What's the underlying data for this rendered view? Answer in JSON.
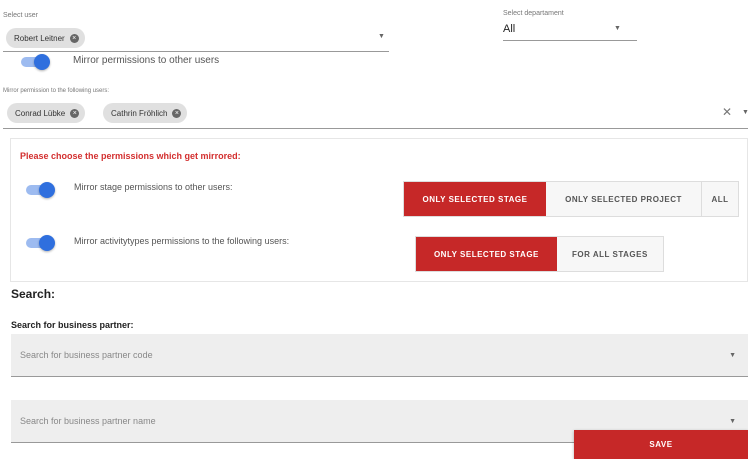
{
  "select_user": {
    "label": "Select user",
    "chips": [
      "Robert Leitner"
    ]
  },
  "select_department": {
    "label": "Select departament",
    "value": "All"
  },
  "mirror_toggle": {
    "label": "Mirror permissions to other users",
    "on": true
  },
  "mirror_users": {
    "label": "Mirror permission to the following users:",
    "chips": [
      "Conrad Lübke",
      "Cathrin Fröhlich"
    ],
    "clear_glyph": "✕"
  },
  "permissions": {
    "heading": "Please choose the permissions which get mirrored:",
    "stage": {
      "label": "Mirror stage permissions to other users:",
      "options": [
        "ONLY SELECTED STAGE",
        "ONLY SELECTED PROJECT",
        "ALL"
      ],
      "selected": "ONLY SELECTED STAGE"
    },
    "activitytypes": {
      "label": "Mirror activitytypes permissions to the following users:",
      "options": [
        "ONLY SELECTED STAGE",
        "FOR ALL STAGES"
      ],
      "selected": "ONLY SELECTED STAGE"
    }
  },
  "search": {
    "heading": "Search:",
    "subheading": "Search for business partner:",
    "code_placeholder": "Search for business partner code",
    "name_placeholder": "Search for business partner name"
  },
  "save_label": "SAVE",
  "colors": {
    "accent_red": "#c62828",
    "toggle_blue": "#2f6fde",
    "heading_red": "#d32f2f"
  },
  "icons": {
    "chip_remove": "cancel-circle-icon",
    "dropdown": "caret-down-icon",
    "clear": "close-icon"
  }
}
